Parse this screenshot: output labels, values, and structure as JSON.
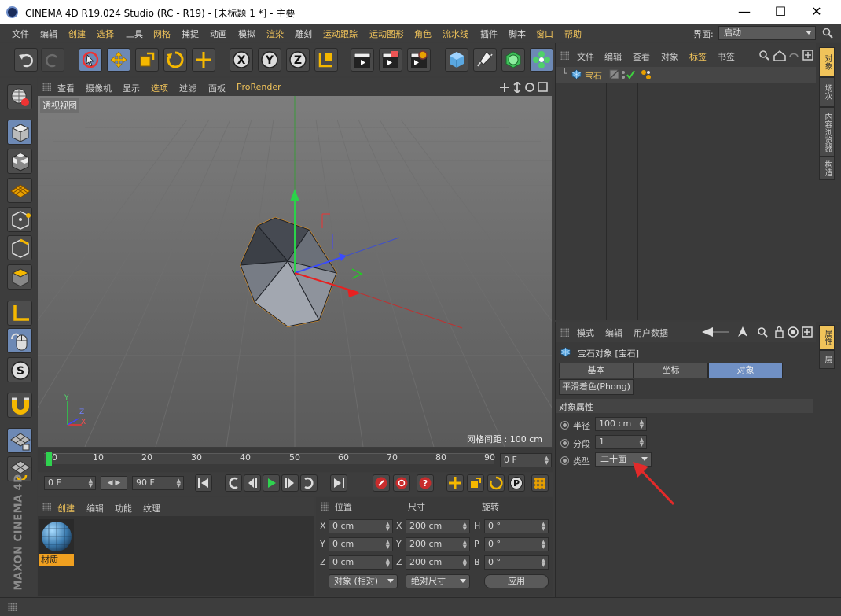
{
  "window": {
    "title": "CINEMA 4D R19.024 Studio (RC - R19) - [未标题 1 *] - 主要",
    "minimize_glyph": "—",
    "maximize_glyph": "☐",
    "close_glyph": "✕"
  },
  "menubar": {
    "items": [
      "文件",
      "编辑",
      "创建",
      "选择",
      "工具",
      "网格",
      "捕捉",
      "动画",
      "模拟",
      "渲染",
      "雕刻",
      "运动跟踪",
      "运动图形",
      "角色",
      "流水线",
      "插件",
      "脚本",
      "窗口",
      "帮助"
    ],
    "layout_label": "界面:",
    "layout_value": "启动"
  },
  "viewport": {
    "menu": [
      "查看",
      "摄像机",
      "显示",
      "选项",
      "过滤",
      "面板",
      "ProRender"
    ],
    "label": "透视视图",
    "grid_spacing": "网格间距 : 100 cm",
    "axes": {
      "x": "X",
      "y": "Y",
      "z": "Z"
    }
  },
  "timeline": {
    "ticks": [
      "0",
      "10",
      "20",
      "30",
      "40",
      "50",
      "60",
      "70",
      "80",
      "90"
    ],
    "current_frame": "0 F",
    "start_field": "0 F",
    "end_field": "90 F"
  },
  "material_panel": {
    "menu": [
      "创建",
      "编辑",
      "功能",
      "纹理"
    ],
    "material_name": "材质"
  },
  "coords_panel": {
    "headers": [
      "位置",
      "尺寸",
      "旋转"
    ],
    "rows": [
      {
        "axis": "X",
        "pos": "0 cm",
        "size_axis": "X",
        "size": "200 cm",
        "rot_axis": "H",
        "rot": "0 °"
      },
      {
        "axis": "Y",
        "pos": "0 cm",
        "size_axis": "Y",
        "size": "200 cm",
        "rot_axis": "P",
        "rot": "0 °"
      },
      {
        "axis": "Z",
        "pos": "0 cm",
        "size_axis": "Z",
        "size": "200 cm",
        "rot_axis": "B",
        "rot": "0 °"
      }
    ],
    "mode_dropdown": "对象 (相对)",
    "size_dropdown": "绝对尺寸",
    "apply_button": "应用"
  },
  "object_manager": {
    "menu": [
      "文件",
      "编辑",
      "查看",
      "对象",
      "标签",
      "书签"
    ],
    "object_name": "宝石",
    "side_tabs": [
      "对象",
      "场次",
      "内容浏览器",
      "构造"
    ]
  },
  "attributes": {
    "menu": [
      "模式",
      "编辑",
      "用户数据"
    ],
    "object_title": "宝石对象 [宝石]",
    "tabs": [
      "基本",
      "坐标",
      "对象"
    ],
    "active_tab": "对象",
    "subtab": "平滑着色(Phong)",
    "section": "对象属性",
    "radius_label": "半径",
    "radius_value": "100 cm",
    "segments_label": "分段",
    "segments_value": "1",
    "type_label": "类型",
    "type_value": "二十面",
    "side_tabs": [
      "属性",
      "层"
    ]
  },
  "branding": {
    "text": "MAXON CINEMA 4D"
  },
  "colors": {
    "accent_blue": "#6d89b5",
    "highlight_yellow": "#f0c35a",
    "arrow_red": "#e32a2a"
  }
}
